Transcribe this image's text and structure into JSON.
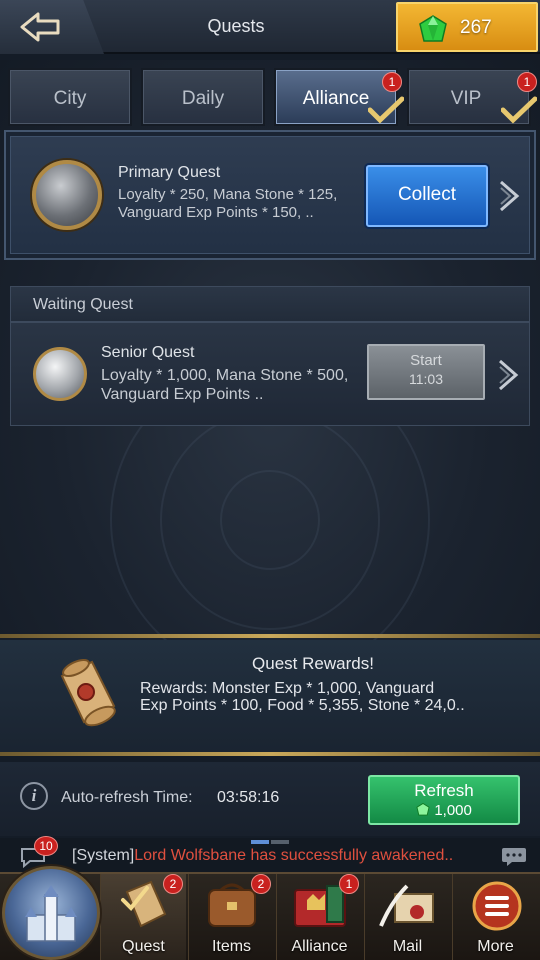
{
  "header": {
    "title": "Quests",
    "back_icon": "back-arrow-icon",
    "gems": "267"
  },
  "tabs": [
    {
      "label": "City",
      "badge": "",
      "active": false
    },
    {
      "label": "Daily",
      "badge": "",
      "active": false
    },
    {
      "label": "Alliance",
      "badge": "1",
      "active": true
    },
    {
      "label": "VIP",
      "badge": "1",
      "active": false
    }
  ],
  "primary_quest": {
    "title": "Primary Quest",
    "desc_line1": "Loyalty * 250, Mana Stone * 125,",
    "desc_line2": "Vanguard Exp Points * 150, ..",
    "button": "Collect"
  },
  "waiting": {
    "header": "Waiting Quest",
    "title": "Senior Quest",
    "desc_line1": "Loyalty * 1,000, Mana Stone * 500,",
    "desc_line2": "Vanguard Exp Points ..",
    "button": "Start",
    "timer": "11:03"
  },
  "rewards": {
    "title": "Quest Rewards!",
    "line1": "Rewards:  Monster Exp * 1,000, Vanguard",
    "line2": "Exp Points * 100, Food * 5,355, Stone * 24,0.."
  },
  "refresh": {
    "label": "Auto-refresh Time:",
    "time": "03:58:16",
    "button": "Refresh",
    "cost": "1,000"
  },
  "chat": {
    "badge": "10",
    "prefix": "[System]",
    "message": "Lord Wolfsbane has successfully awakened.."
  },
  "nav": [
    {
      "label": "Quest",
      "badge": "2",
      "icon": "quest-scroll-icon"
    },
    {
      "label": "Items",
      "badge": "2",
      "icon": "items-bag-icon"
    },
    {
      "label": "Alliance",
      "badge": "1",
      "icon": "alliance-chest-icon"
    },
    {
      "label": "Mail",
      "badge": "",
      "icon": "mail-icon"
    },
    {
      "label": "More",
      "badge": "",
      "icon": "more-menu-icon"
    }
  ],
  "colors": {
    "gold": "#f3b733",
    "collect_blue": "#1557b6",
    "refresh_green": "#138a45",
    "badge_red": "#c9211f",
    "chat_red": "#e0503f"
  }
}
